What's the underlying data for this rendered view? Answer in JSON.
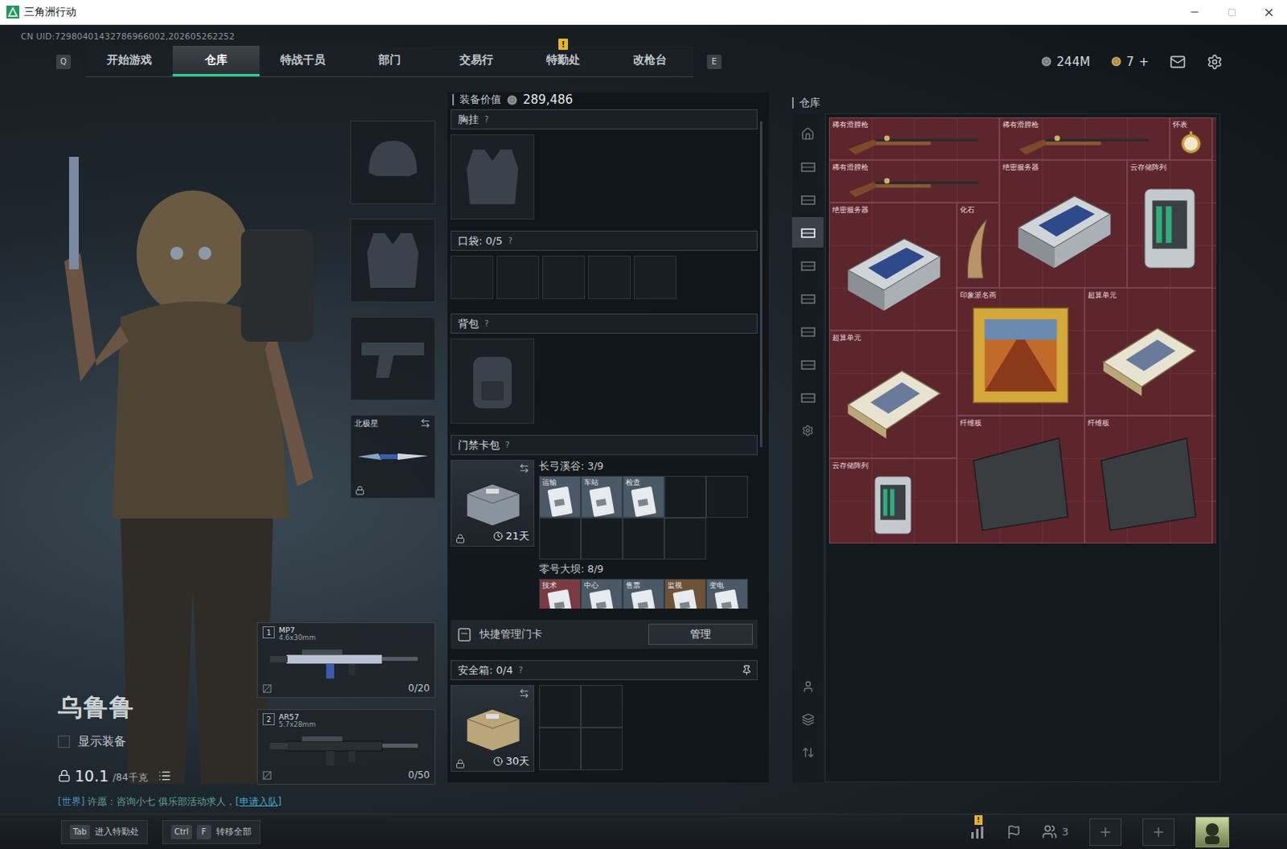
{
  "window": {
    "title": "三角洲行动"
  },
  "uid": "CN UID:72980401432786966002,202605262252",
  "nav": {
    "prev_key": "Q",
    "next_key": "E",
    "alert_mark": "!",
    "tabs": [
      {
        "label": "开始游戏",
        "selected": false,
        "alert": false
      },
      {
        "label": "仓库",
        "selected": true,
        "alert": false
      },
      {
        "label": "特战干员",
        "selected": false,
        "alert": false
      },
      {
        "label": "部门",
        "selected": false,
        "alert": false
      },
      {
        "label": "交易行",
        "selected": false,
        "alert": false
      },
      {
        "label": "特勤处",
        "selected": false,
        "alert": true
      },
      {
        "label": "改枪台",
        "selected": false,
        "alert": false
      }
    ]
  },
  "currency": {
    "coins": "244M",
    "tickets": "7",
    "add": "+"
  },
  "operator": {
    "name": "乌鲁鲁",
    "show_gear": {
      "label": "显示装备",
      "checked": false
    },
    "weight": "10.1",
    "capacity": "/84千克"
  },
  "gear_slots": [
    {
      "kind": "helmet",
      "locked": false,
      "swap": false
    },
    {
      "kind": "armor",
      "locked": false,
      "swap": false
    },
    {
      "kind": "pistol",
      "locked": false,
      "swap": false
    },
    {
      "kind": "melee",
      "label": "北极星",
      "locked": true,
      "swap": true
    }
  ],
  "weapons": [
    {
      "slot": "1",
      "name": "MP7",
      "caliber": "4.6x30mm",
      "ammo": "0/20"
    },
    {
      "slot": "2",
      "name": "AR57",
      "caliber": "5.7x28mm",
      "ammo": "0/50"
    }
  ],
  "chat": {
    "channel": "[世界]",
    "message": " 许愿：咨询小七 俱乐部活动求人，",
    "action": "[申请入队]"
  },
  "loadout": {
    "value_label": "装备价值",
    "value": "289,486",
    "help": "?",
    "chest_rig": {
      "title": "胸挂"
    },
    "pockets": {
      "title": "口袋: 0/5",
      "slots": 5
    },
    "backpack": {
      "title": "背包"
    },
    "keycards": {
      "title": "门禁卡包",
      "days": "21天",
      "locked": true,
      "swap": true,
      "regions": [
        {
          "title": "长弓溪谷: 3/9",
          "slots": 9,
          "cards": [
            {
              "label": "运输",
              "color": "#4b5866"
            },
            {
              "label": "车站",
              "color": "#4b5866"
            },
            {
              "label": "检查",
              "color": "#4b5866"
            }
          ]
        },
        {
          "title": "零号大坝: 8/9",
          "slots": 5,
          "cards": [
            {
              "label": "技术",
              "color": "#7a3a42"
            },
            {
              "label": "中心",
              "color": "#4b5866"
            },
            {
              "label": "售票",
              "color": "#4b5866"
            },
            {
              "label": "监视",
              "color": "#6e5238"
            },
            {
              "label": "变电",
              "color": "#4b5866"
            }
          ]
        }
      ],
      "quick_manage": "快捷管理门卡",
      "manage_button": "管理"
    },
    "safe_box": {
      "title": "安全箱: 0/4",
      "days": "30天",
      "locked": true,
      "swap": true,
      "slots": 4
    }
  },
  "warehouse": {
    "title": "仓库",
    "tabs": [
      {
        "kind": "home",
        "selected": false
      },
      {
        "kind": "shelf",
        "selected": false
      },
      {
        "kind": "shelf",
        "selected": false
      },
      {
        "kind": "shelf",
        "selected": true
      },
      {
        "kind": "shelf",
        "selected": false
      },
      {
        "kind": "shelf",
        "selected": false
      },
      {
        "kind": "shelf",
        "selected": false
      },
      {
        "kind": "shelf",
        "selected": false
      },
      {
        "kind": "shelf",
        "selected": false
      },
      {
        "kind": "settings",
        "selected": false
      }
    ],
    "tools": [
      {
        "kind": "person"
      },
      {
        "kind": "layers"
      },
      {
        "kind": "transfer"
      }
    ],
    "items": [
      {
        "name": "稀有滑膛枪",
        "kind": "rifle"
      },
      {
        "name": "稀有滑膛枪",
        "kind": "rifle"
      },
      {
        "name": "怀表",
        "kind": "watch"
      },
      {
        "name": "稀有滑膛枪",
        "kind": "rifle"
      },
      {
        "name": "绝密服务器",
        "kind": "server"
      },
      {
        "name": "云存储阵列",
        "kind": "storage"
      },
      {
        "name": "绝密服务器",
        "kind": "server"
      },
      {
        "name": "化石",
        "kind": "fossil"
      },
      {
        "name": "印象派名画",
        "kind": "painting"
      },
      {
        "name": "超算单元",
        "kind": "chip"
      },
      {
        "name": "超算单元",
        "kind": "chip"
      },
      {
        "name": "纤维板",
        "kind": "board"
      },
      {
        "name": "纤维板",
        "kind": "board"
      },
      {
        "name": "云存储阵列",
        "kind": "storage"
      }
    ]
  },
  "bottom": {
    "hints": [
      {
        "keys": [
          "Tab"
        ],
        "label": "进入特勤处"
      },
      {
        "keys": [
          "Ctrl",
          "F"
        ],
        "label": "转移全部"
      }
    ],
    "alert_mark": "!",
    "party_count": "3",
    "slots": 2
  }
}
